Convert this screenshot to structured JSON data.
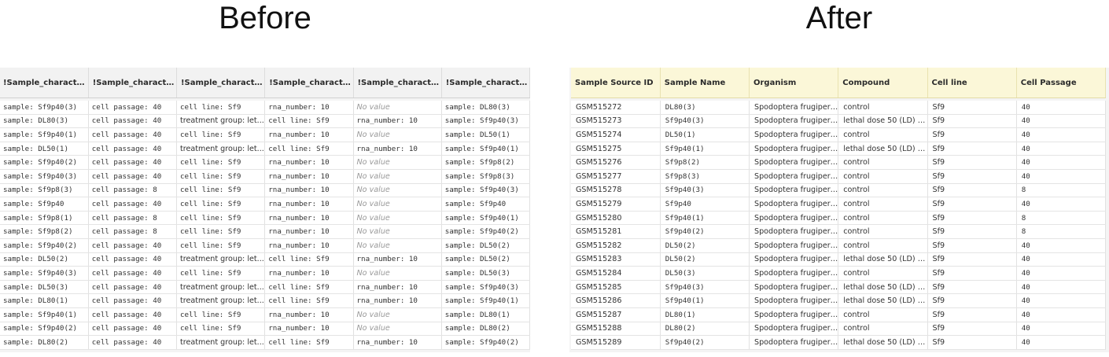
{
  "before": {
    "title": "Before",
    "columns": [
      "!Sample_characteri...",
      "!Sample_characteri...",
      "!Sample_characteri...",
      "!Sample_characteri...",
      "!Sample_characteri...",
      "!Sample_characteri..."
    ],
    "rows": [
      [
        "sample: Sf9p40(3)",
        "cell passage: 40",
        "cell line: Sf9",
        "rna_number: 10",
        "No value",
        "sample: DL80(3)"
      ],
      [
        "sample: DL80(3)",
        "cell passage: 40",
        "treatment group: let...",
        "cell line: Sf9",
        "rna_number: 10",
        "sample: Sf9p40(3)"
      ],
      [
        "sample: Sf9p40(1)",
        "cell passage: 40",
        "cell line: Sf9",
        "rna_number: 10",
        "No value",
        "sample: DL50(1)"
      ],
      [
        "sample: DL50(1)",
        "cell passage: 40",
        "treatment group: let...",
        "cell line: Sf9",
        "rna_number: 10",
        "sample: Sf9p40(1)"
      ],
      [
        "sample: Sf9p40(2)",
        "cell passage: 40",
        "cell line: Sf9",
        "rna_number: 10",
        "No value",
        "sample: Sf9p8(2)"
      ],
      [
        "sample: Sf9p40(3)",
        "cell passage: 40",
        "cell line: Sf9",
        "rna_number: 10",
        "No value",
        "sample: Sf9p8(3)"
      ],
      [
        "sample: Sf9p8(3)",
        "cell passage: 8",
        "cell line: Sf9",
        "rna_number: 10",
        "No value",
        "sample: Sf9p40(3)"
      ],
      [
        "sample: Sf9p40",
        "cell passage: 40",
        "cell line: Sf9",
        "rna_number: 10",
        "No value",
        "sample: Sf9p40"
      ],
      [
        "sample: Sf9p8(1)",
        "cell passage: 8",
        "cell line: Sf9",
        "rna_number: 10",
        "No value",
        "sample: Sf9p40(1)"
      ],
      [
        "sample: Sf9p8(2)",
        "cell passage: 8",
        "cell line: Sf9",
        "rna_number: 10",
        "No value",
        "sample: Sf9p40(2)"
      ],
      [
        "sample: Sf9p40(2)",
        "cell passage: 40",
        "cell line: Sf9",
        "rna_number: 10",
        "No value",
        "sample: DL50(2)"
      ],
      [
        "sample: DL50(2)",
        "cell passage: 40",
        "treatment group: let...",
        "cell line: Sf9",
        "rna_number: 10",
        "sample: DL50(2)"
      ],
      [
        "sample: Sf9p40(3)",
        "cell passage: 40",
        "cell line: Sf9",
        "rna_number: 10",
        "No value",
        "sample: DL50(3)"
      ],
      [
        "sample: DL50(3)",
        "cell passage: 40",
        "treatment group: let...",
        "cell line: Sf9",
        "rna_number: 10",
        "sample: Sf9p40(3)"
      ],
      [
        "sample: DL80(1)",
        "cell passage: 40",
        "treatment group: let...",
        "cell line: Sf9",
        "rna_number: 10",
        "sample: Sf9p40(1)"
      ],
      [
        "sample: Sf9p40(1)",
        "cell passage: 40",
        "cell line: Sf9",
        "rna_number: 10",
        "No value",
        "sample: DL80(1)"
      ],
      [
        "sample: Sf9p40(2)",
        "cell passage: 40",
        "cell line: Sf9",
        "rna_number: 10",
        "No value",
        "sample: DL80(2)"
      ],
      [
        "sample: DL80(2)",
        "cell passage: 40",
        "treatment group: let...",
        "cell line: Sf9",
        "rna_number: 10",
        "sample: Sf9p40(2)"
      ]
    ]
  },
  "after": {
    "title": "After",
    "columns": [
      "Sample Source ID",
      "Sample Name",
      "Organism",
      "Compound",
      "Cell line",
      "Cell Passage"
    ],
    "rows": [
      [
        "GSM515272",
        "DL80(3)",
        "Spodoptera frugiperda",
        "control",
        "Sf9",
        "40"
      ],
      [
        "GSM515273",
        "Sf9p40(3)",
        "Spodoptera frugiperda",
        "lethal dose 50 (LD) o...",
        "Sf9",
        "40"
      ],
      [
        "GSM515274",
        "DL50(1)",
        "Spodoptera frugiperda",
        "control",
        "Sf9",
        "40"
      ],
      [
        "GSM515275",
        "Sf9p40(1)",
        "Spodoptera frugiperda",
        "lethal dose 50 (LD) o...",
        "Sf9",
        "40"
      ],
      [
        "GSM515276",
        "Sf9p8(2)",
        "Spodoptera frugiperda",
        "control",
        "Sf9",
        "40"
      ],
      [
        "GSM515277",
        "Sf9p8(3)",
        "Spodoptera frugiperda",
        "control",
        "Sf9",
        "40"
      ],
      [
        "GSM515278",
        "Sf9p40(3)",
        "Spodoptera frugiperda",
        "control",
        "Sf9",
        "8"
      ],
      [
        "GSM515279",
        "Sf9p40",
        "Spodoptera frugiperda",
        "control",
        "Sf9",
        "40"
      ],
      [
        "GSM515280",
        "Sf9p40(1)",
        "Spodoptera frugiperda",
        "control",
        "Sf9",
        "8"
      ],
      [
        "GSM515281",
        "Sf9p40(2)",
        "Spodoptera frugiperda",
        "control",
        "Sf9",
        "8"
      ],
      [
        "GSM515282",
        "DL50(2)",
        "Spodoptera frugiperda",
        "control",
        "Sf9",
        "40"
      ],
      [
        "GSM515283",
        "DL50(2)",
        "Spodoptera frugiperda",
        "lethal dose 50 (LD) o...",
        "Sf9",
        "40"
      ],
      [
        "GSM515284",
        "DL50(3)",
        "Spodoptera frugiperda",
        "control",
        "Sf9",
        "40"
      ],
      [
        "GSM515285",
        "Sf9p40(3)",
        "Spodoptera frugiperda",
        "lethal dose 50 (LD) o...",
        "Sf9",
        "40"
      ],
      [
        "GSM515286",
        "Sf9p40(1)",
        "Spodoptera frugiperda",
        "lethal dose 50 (LD) o...",
        "Sf9",
        "40"
      ],
      [
        "GSM515287",
        "DL80(1)",
        "Spodoptera frugiperda",
        "control",
        "Sf9",
        "40"
      ],
      [
        "GSM515288",
        "DL80(2)",
        "Spodoptera frugiperda",
        "control",
        "Sf9",
        "40"
      ],
      [
        "GSM515289",
        "Sf9p40(2)",
        "Spodoptera frugiperda",
        "lethal dose 50 (LD) o...",
        "Sf9",
        "40"
      ]
    ]
  },
  "placeholder_value": "No value"
}
